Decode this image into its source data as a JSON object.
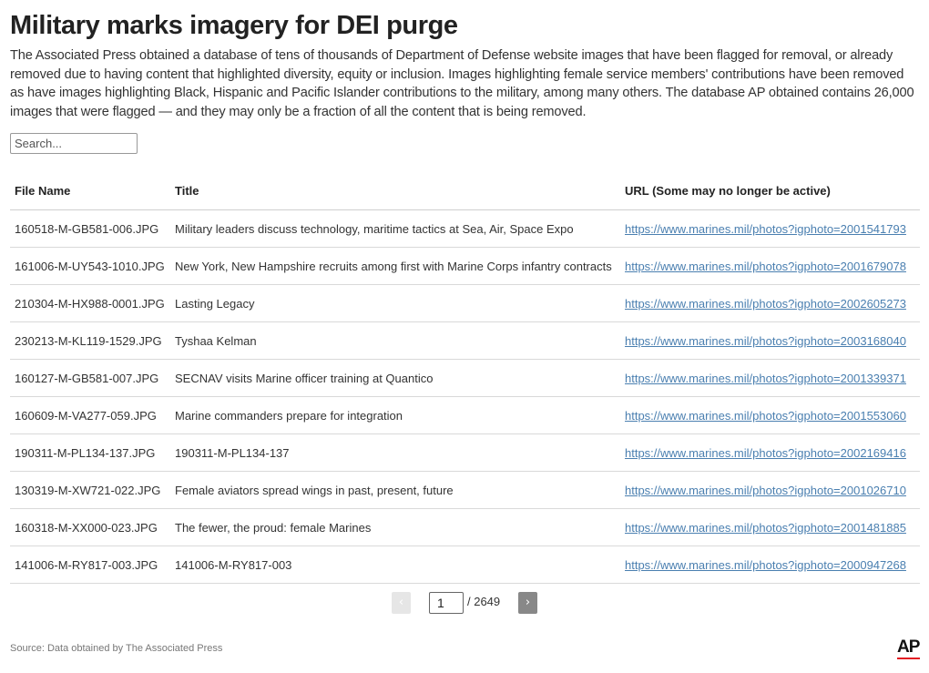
{
  "title": "Military marks imagery for DEI purge",
  "description": "The Associated Press obtained a database of tens of thousands of Department of Defense website images that have been flagged for removal, or already removed due to having content that highlighted diversity, equity or inclusion. Images highlighting female service members' contributions have been removed as have images highlighting Black, Hispanic and Pacific Islander contributions to the military, among many others. The database AP obtained contains 26,000 images that were flagged — and they may only be a fraction of all the content that is being removed.",
  "search": {
    "placeholder": "Search...",
    "value": ""
  },
  "table": {
    "columns": [
      "File Name",
      "Title",
      "URL (Some may no longer be active)"
    ],
    "rows": [
      {
        "file": "160518-M-GB581-006.JPG",
        "title": "Military leaders discuss technology, maritime tactics at Sea, Air, Space Expo",
        "url": "https://www.marines.mil/photos?igphoto=2001541793"
      },
      {
        "file": "161006-M-UY543-1010.JPG",
        "title": "New York, New Hampshire recruits among first with Marine Corps infantry contracts",
        "url": "https://www.marines.mil/photos?igphoto=2001679078"
      },
      {
        "file": "210304-M-HX988-0001.JPG",
        "title": "Lasting Legacy",
        "url": "https://www.marines.mil/photos?igphoto=2002605273"
      },
      {
        "file": "230213-M-KL119-1529.JPG",
        "title": "Tyshaa Kelman",
        "url": "https://www.marines.mil/photos?igphoto=2003168040"
      },
      {
        "file": "160127-M-GB581-007.JPG",
        "title": "SECNAV visits Marine officer training at Quantico",
        "url": "https://www.marines.mil/photos?igphoto=2001339371"
      },
      {
        "file": "160609-M-VA277-059.JPG",
        "title": "Marine commanders prepare for integration",
        "url": "https://www.marines.mil/photos?igphoto=2001553060"
      },
      {
        "file": "190311-M-PL134-137.JPG",
        "title": "190311-M-PL134-137",
        "url": "https://www.marines.mil/photos?igphoto=2002169416"
      },
      {
        "file": "130319-M-XW721-022.JPG",
        "title": "Female aviators spread wings in past, present, future",
        "url": "https://www.marines.mil/photos?igphoto=2001026710"
      },
      {
        "file": "160318-M-XX000-023.JPG",
        "title": "The fewer, the proud: female Marines",
        "url": "https://www.marines.mil/photos?igphoto=2001481885"
      },
      {
        "file": "141006-M-RY817-003.JPG",
        "title": "141006-M-RY817-003",
        "url": "https://www.marines.mil/photos?igphoto=2000947268"
      }
    ]
  },
  "pagination": {
    "prev_label": "‹",
    "next_label": "›",
    "current_page": "1",
    "total_label": "/ 2649"
  },
  "source": "Source: Data obtained by The Associated Press",
  "logo": {
    "text": "AP",
    "accent_color": "#e31b23"
  },
  "colors": {
    "link": "#4a7fb0",
    "text": "#333333",
    "rule": "#d9d9d9"
  }
}
